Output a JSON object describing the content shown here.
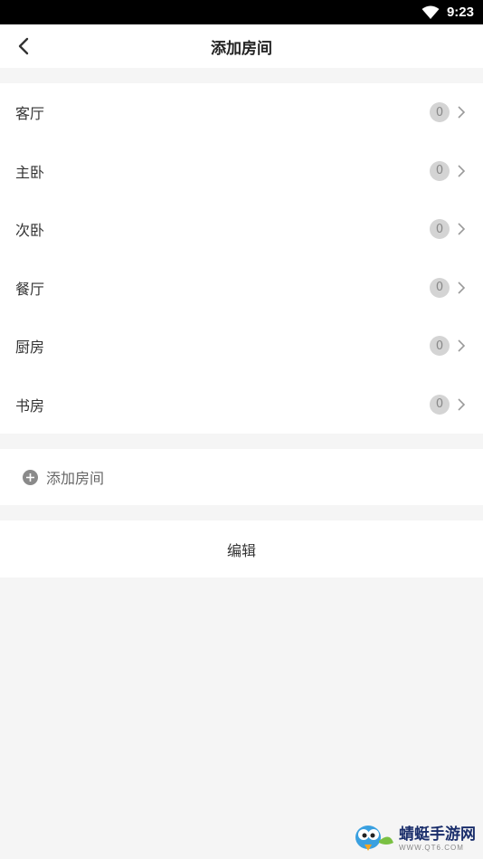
{
  "status_bar": {
    "time": "9:23"
  },
  "nav": {
    "title": "添加房间"
  },
  "rooms": [
    {
      "name": "客厅",
      "count": "0"
    },
    {
      "name": "主卧",
      "count": "0"
    },
    {
      "name": "次卧",
      "count": "0"
    },
    {
      "name": "餐厅",
      "count": "0"
    },
    {
      "name": "厨房",
      "count": "0"
    },
    {
      "name": "书房",
      "count": "0"
    }
  ],
  "add_room": {
    "label": "添加房间",
    "icon": "plus-circle-icon"
  },
  "edit": {
    "label": "编辑"
  },
  "watermark": {
    "title": "蜻蜓手游网",
    "url": "WWW.QT6.COM"
  },
  "colors": {
    "background": "#f5f5f5",
    "badge": "#d4d4d4",
    "status_bar": "#000000"
  }
}
